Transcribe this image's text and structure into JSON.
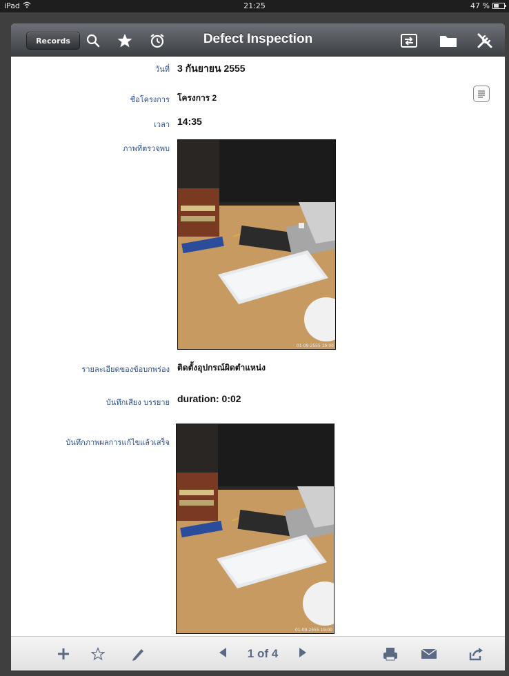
{
  "status_bar": {
    "device": "iPad",
    "time": "21:25",
    "battery": "47 %"
  },
  "navbar": {
    "records_label": "Records",
    "title": "Defect Inspection"
  },
  "form": {
    "date": {
      "label": "วันที่",
      "value": "3 กันยายน 2555"
    },
    "project": {
      "label": "ชื่อโครงการ",
      "value": "โครงการ 2"
    },
    "time": {
      "label": "เวลา",
      "value": "14:35"
    },
    "defect_photo": {
      "label": "ภาพที่ตรวจพบ",
      "stamp": "01-09-2555 19:00"
    },
    "defect_detail": {
      "label": "รายละเอียดของข้อบกพร่อง",
      "value": "ติดตั้งอุปกรณ์ผิดตำแหน่ง"
    },
    "voice_note": {
      "label": "บันทึกเสียง บรรยาย",
      "value": "duration: 0:02"
    },
    "fixed_photo": {
      "label": "บันทึกภาพผลการแก้ไขแล้วเสร็จ",
      "stamp": "01-09-2555 19:00"
    }
  },
  "toolbar": {
    "pager": "1 of 4"
  },
  "colors": {
    "label_blue": "#2b4f8f",
    "nav_dark": "#3c3f44",
    "toolbar_icon": "#5a6a84"
  }
}
